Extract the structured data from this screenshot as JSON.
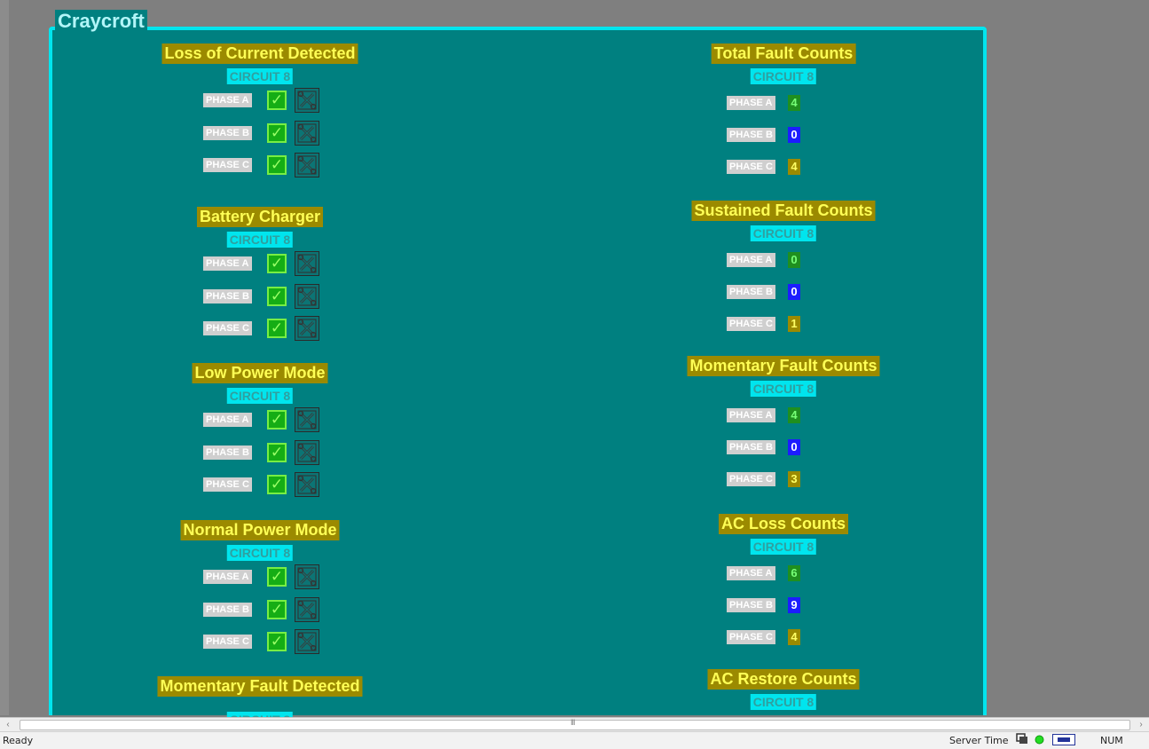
{
  "panel": {
    "title": "Craycroft"
  },
  "circuit_label": "CIRCUIT 8",
  "phases": [
    "PHASE A",
    "PHASE B",
    "PHASE C"
  ],
  "indicators": {
    "ok": "✓"
  },
  "left_sections": [
    {
      "title": "Loss of Current Detected"
    },
    {
      "title": "Battery Charger"
    },
    {
      "title": "Low Power Mode"
    },
    {
      "title": "Normal Power Mode"
    },
    {
      "title": "Momentary Fault Detected"
    }
  ],
  "right_sections": [
    {
      "title": "Total Fault Counts",
      "values": [
        "4",
        "0",
        "4"
      ]
    },
    {
      "title": "Sustained Fault Counts",
      "values": [
        "0",
        "0",
        "1"
      ]
    },
    {
      "title": "Momentary Fault Counts",
      "values": [
        "4",
        "0",
        "3"
      ]
    },
    {
      "title": "AC Loss Counts",
      "values": [
        "6",
        "9",
        "4"
      ]
    },
    {
      "title": "AC Restore Counts",
      "values": []
    }
  ],
  "colors": {
    "panel_bg": "#008080",
    "panel_border": "#00e5ee",
    "title_bg": "#9b8a00",
    "title_text": "#ffff55",
    "count_phase_a": "#1f8f1f",
    "count_phase_b": "#1c1cff",
    "count_phase_c": "#9b8a00"
  },
  "status_bar": {
    "ready": "Ready",
    "server_time": "Server Time",
    "num": "NUM"
  },
  "scrollbar": {
    "grip": "III",
    "left_arrow": "‹",
    "right_arrow": "›"
  }
}
